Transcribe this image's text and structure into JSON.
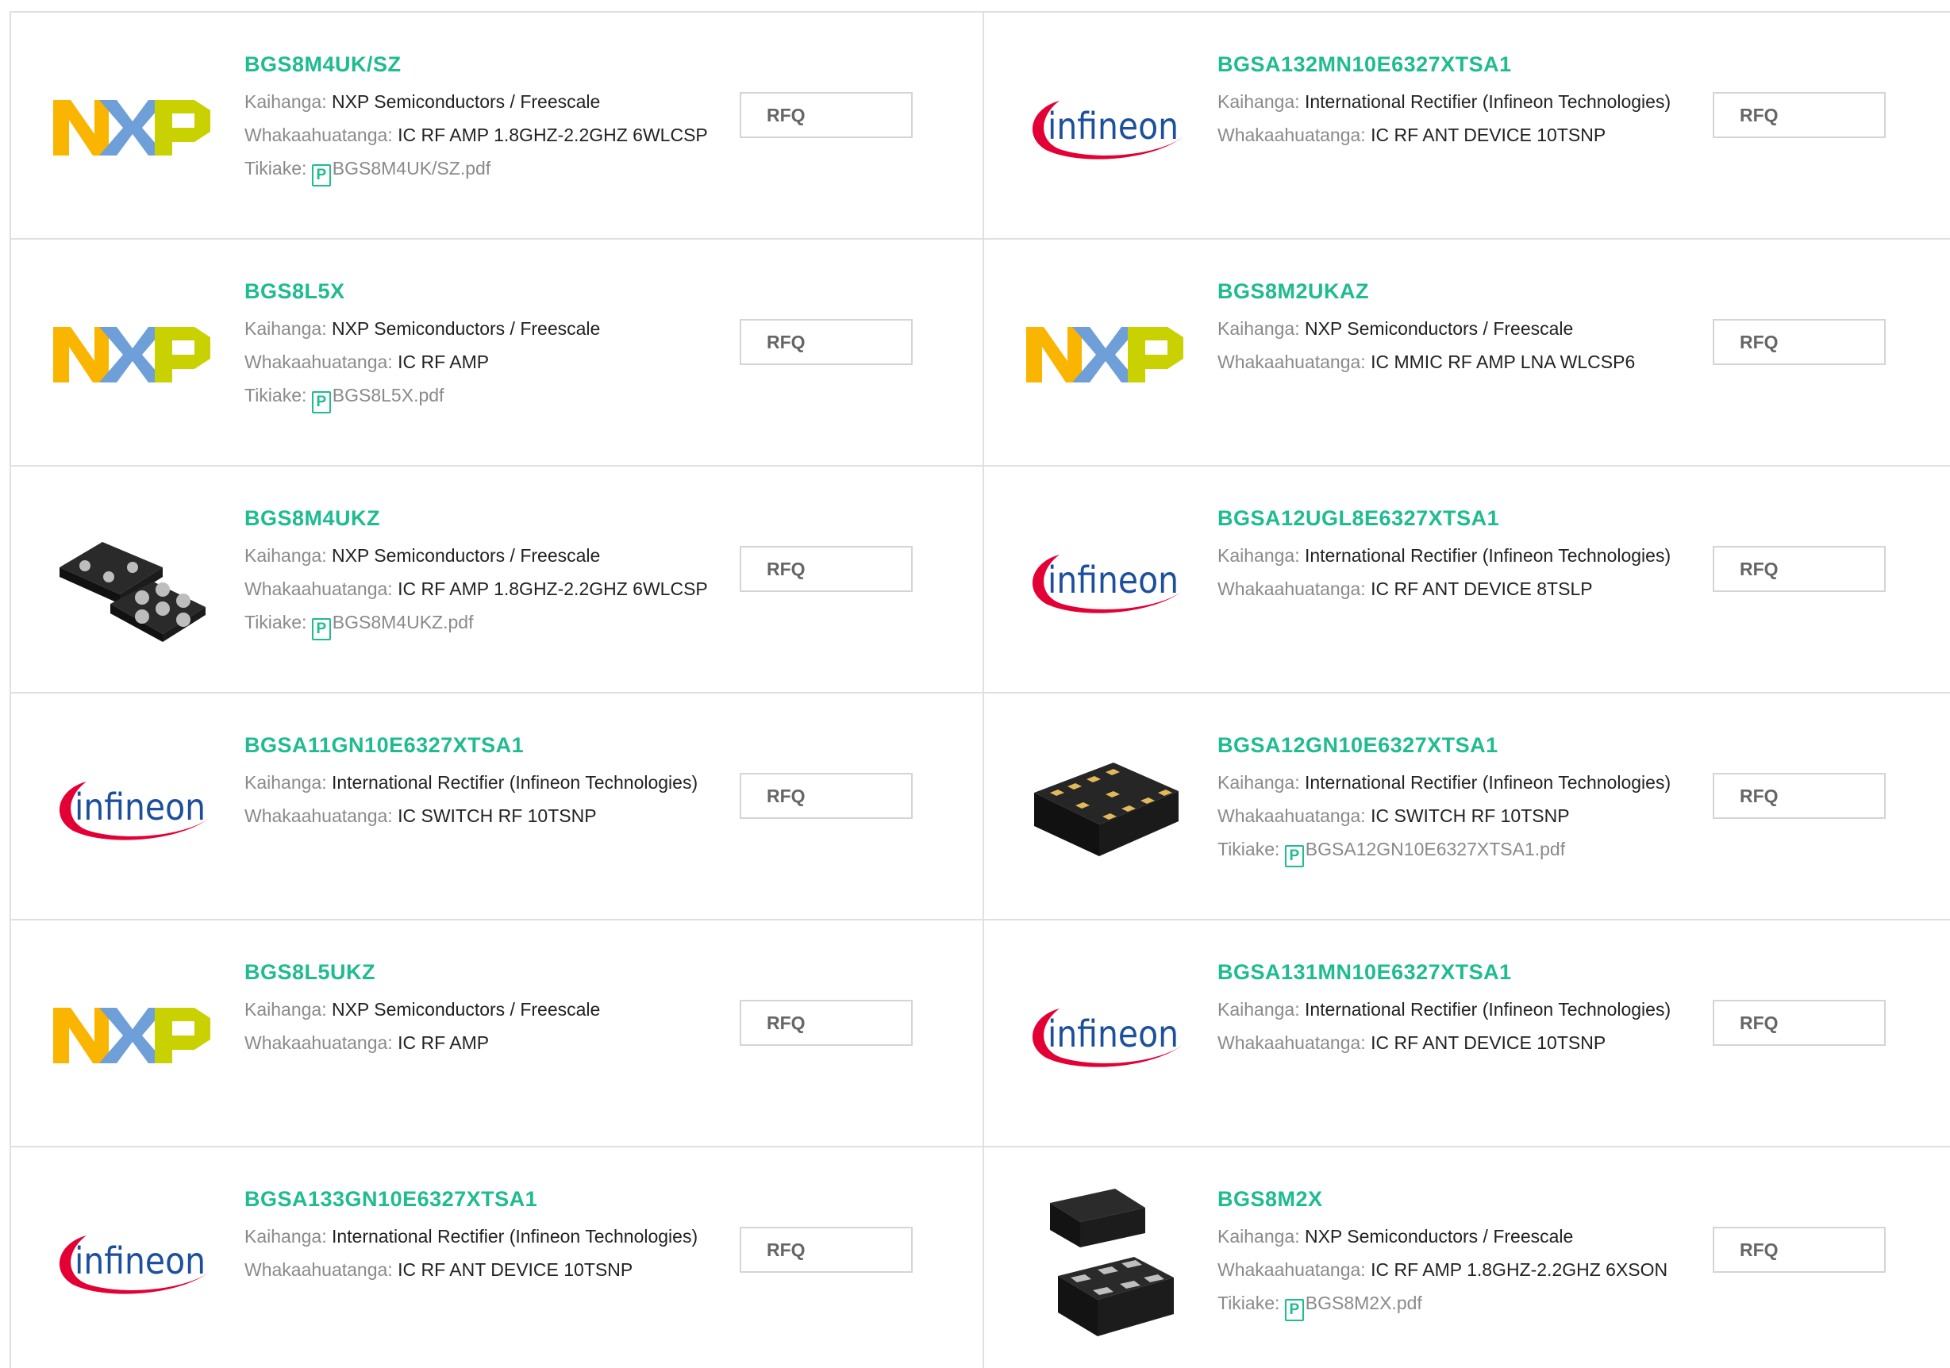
{
  "labels": {
    "manufacturer": "Kaihanga:",
    "description": "Whakaahuatanga:",
    "datasheet": "Tikiake:",
    "rfq": "RFQ"
  },
  "colors": {
    "accent": "#1fbb91",
    "nxp_orange": "#f9b500",
    "nxp_blue": "#6f9fd8",
    "nxp_green": "#c9d200",
    "infineon_blue": "#1c4f9c",
    "infineon_red": "#e30034"
  },
  "products": [
    {
      "part": "BGS8M4UK/SZ",
      "manufacturer": "NXP Semiconductors / Freescale",
      "description": "IC RF AMP 1.8GHZ-2.2GHZ 6WLCSP",
      "datasheet": "BGS8M4UK/SZ.pdf",
      "image": "nxp-logo"
    },
    {
      "part": "BGSA132MN10E6327XTSA1",
      "manufacturer": "International Rectifier (Infineon Technologies)",
      "description": "IC RF ANT DEVICE 10TSNP",
      "datasheet": null,
      "image": "infineon-logo"
    },
    {
      "part": "BGS8L5X",
      "manufacturer": "NXP Semiconductors / Freescale",
      "description": "IC RF AMP",
      "datasheet": "BGS8L5X.pdf",
      "image": "nxp-logo"
    },
    {
      "part": "BGS8M2UKAZ",
      "manufacturer": "NXP Semiconductors / Freescale",
      "description": "IC MMIC RF AMP LNA WLCSP6",
      "datasheet": null,
      "image": "nxp-logo"
    },
    {
      "part": "BGS8M4UKZ",
      "manufacturer": "NXP Semiconductors / Freescale",
      "description": "IC RF AMP 1.8GHZ-2.2GHZ 6WLCSP",
      "datasheet": "BGS8M4UKZ.pdf",
      "image": "chip-wlcsp6"
    },
    {
      "part": "BGSA12UGL8E6327XTSA1",
      "manufacturer": "International Rectifier (Infineon Technologies)",
      "description": "IC RF ANT DEVICE 8TSLP",
      "datasheet": null,
      "image": "infineon-logo"
    },
    {
      "part": "BGSA11GN10E6327XTSA1",
      "manufacturer": "International Rectifier (Infineon Technologies)",
      "description": "IC SWITCH RF 10TSNP",
      "datasheet": null,
      "image": "infineon-logo"
    },
    {
      "part": "BGSA12GN10E6327XTSA1",
      "manufacturer": "International Rectifier (Infineon Technologies)",
      "description": "IC SWITCH RF 10TSNP",
      "datasheet": "BGSA12GN10E6327XTSA1.pdf",
      "image": "chip-tsnp10"
    },
    {
      "part": "BGS8L5UKZ",
      "manufacturer": "NXP Semiconductors / Freescale",
      "description": "IC RF AMP",
      "datasheet": null,
      "image": "nxp-logo"
    },
    {
      "part": "BGSA131MN10E6327XTSA1",
      "manufacturer": "International Rectifier (Infineon Technologies)",
      "description": "IC RF ANT DEVICE 10TSNP",
      "datasheet": null,
      "image": "infineon-logo"
    },
    {
      "part": "BGSA133GN10E6327XTSA1",
      "manufacturer": "International Rectifier (Infineon Technologies)",
      "description": "IC RF ANT DEVICE 10TSNP",
      "datasheet": null,
      "image": "infineon-logo"
    },
    {
      "part": "BGS8M2X",
      "manufacturer": "NXP Semiconductors / Freescale",
      "description": "IC RF AMP 1.8GHZ-2.2GHZ 6XSON",
      "datasheet": "BGS8M2X.pdf",
      "image": "chip-xson6"
    }
  ]
}
